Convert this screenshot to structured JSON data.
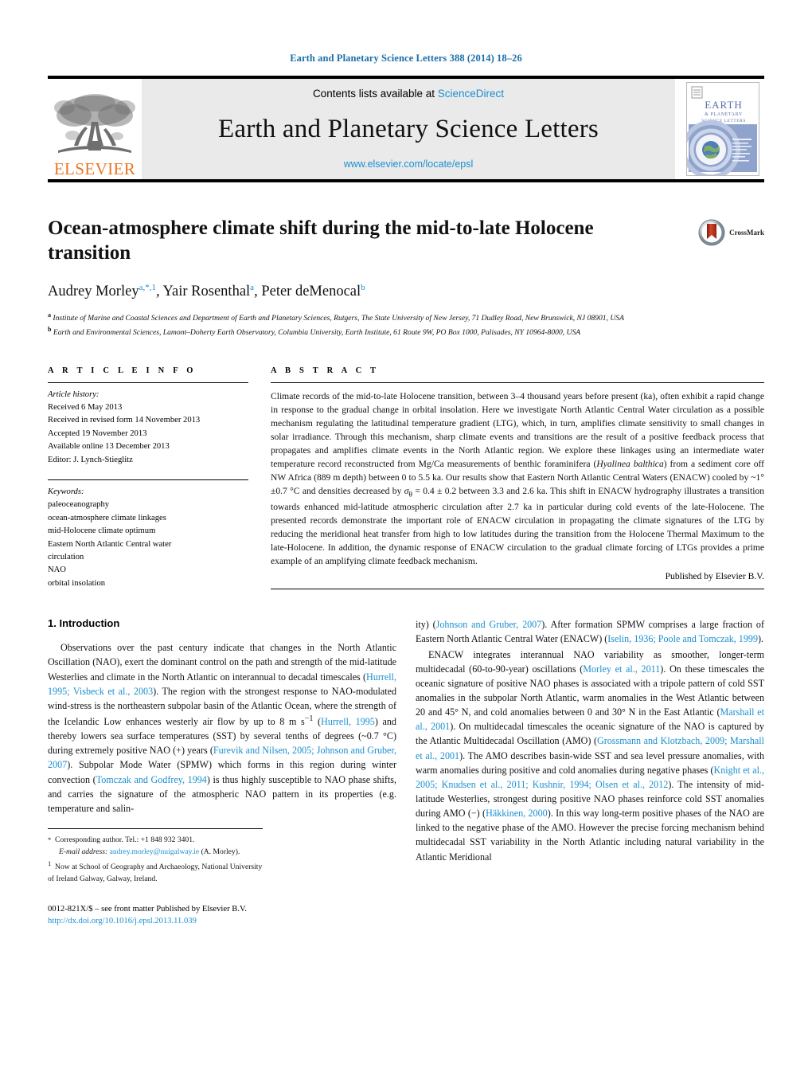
{
  "running_head": "Earth and Planetary Science Letters 388 (2014) 18–26",
  "masthead": {
    "contents_text": "Contents lists available at ",
    "sciencedirect": "ScienceDirect",
    "journal_name": "Earth and Planetary Science Letters",
    "journal_url": "www.elsevier.com/locate/epsl",
    "publisher_wordmark": "ELSEVIER",
    "cover_title_line1": "EARTH",
    "cover_title_line2": "& PLANETARY",
    "cover_title_line3": "SCIENCE LETTERS"
  },
  "crossmark": {
    "label": "CrossMark"
  },
  "article": {
    "title": "Ocean-atmosphere climate shift during the mid-to-late Holocene transition",
    "authors_html": "Audrey Morley<sup>a,*,1</sup>, Yair Rosenthal<sup>a</sup>, Peter deMenocal<sup>b</sup>",
    "affiliation_a": "Institute of Marine and Coastal Sciences and Department of Earth and Planetary Sciences, Rutgers, The State University of New Jersey, 71 Dudley Road, New Brunswick, NJ 08901, USA",
    "affiliation_b": "Earth and Environmental Sciences, Lamont–Doherty Earth Observatory, Columbia University, Earth Institute, 61 Route 9W, PO Box 1000, Palisades, NY 10964-8000, USA"
  },
  "article_info": {
    "heading": "A R T I C L E   I N F O",
    "history_label": "Article history:",
    "history": [
      "Received 6 May 2013",
      "Received in revised form 14 November 2013",
      "Accepted 19 November 2013",
      "Available online 13 December 2013",
      "Editor: J. Lynch-Stieglitz"
    ],
    "keywords_label": "Keywords:",
    "keywords": [
      "paleoceanography",
      "ocean-atmosphere climate linkages",
      "mid-Holocene climate optimum",
      "Eastern North Atlantic Central water",
      "circulation",
      "NAO",
      "orbital insolation"
    ]
  },
  "abstract": {
    "heading": "A B S T R A C T",
    "text_html": "Climate records of the mid-to-late Holocene transition, between 3–4 thousand years before present (ka), often exhibit a rapid change in response to the gradual change in orbital insolation. Here we investigate North Atlantic Central Water circulation as a possible mechanism regulating the latitudinal temperature gradient (LTG), which, in turn, amplifies climate sensitivity to small changes in solar irradiance. Through this mechanism, sharp climate events and transitions are the result of a positive feedback process that propagates and amplifies climate events in the North Atlantic region. We explore these linkages using an intermediate water temperature record reconstructed from Mg/Ca measurements of benthic foraminifera (<i>Hyalinea balthica</i>) from a sediment core off NW Africa (889 m depth) between 0 to 5.5 ka. Our results show that Eastern North Atlantic Central Waters (ENACW) cooled by ~1°±0.7 °C and densities decreased by <i>σ</i><sub>θ</sub> = 0.4 ± 0.2 between 3.3 and 2.6 ka. This shift in ENACW hydrography illustrates a transition towards enhanced mid-latitude atmospheric circulation after 2.7 ka in particular during cold events of the late-Holocene. The presented records demonstrate the important role of ENACW circulation in propagating the climate signatures of the LTG by reducing the meridional heat transfer from high to low latitudes during the transition from the Holocene Thermal Maximum to the late-Holocene. In addition, the dynamic response of ENACW circulation to the gradual climate forcing of LTGs provides a prime example of an amplifying climate feedback mechanism.",
    "published_by": "Published by Elsevier B.V."
  },
  "introduction": {
    "section_title": "1. Introduction",
    "left_paragraph_html": "Observations over the past century indicate that changes in the North Atlantic Oscillation (NAO), exert the dominant control on the path and strength of the mid-latitude Westerlies and climate in the North Atlantic on interannual to decadal timescales (<span class=\"ref\">Hurrell, 1995; Visbeck et al., 2003</span>). The region with the strongest response to NAO-modulated wind-stress is the northeastern subpolar basin of the Atlantic Ocean, where the strength of the Icelandic Low enhances westerly air flow by up to 8 m s<sup>−1</sup> (<span class=\"ref\">Hurrell, 1995</span>) and thereby lowers sea surface temperatures (SST) by several tenths of degrees (~0.7 °C) during extremely positive NAO (+) years (<span class=\"ref\">Furevik and Nilsen, 2005; Johnson and Gruber, 2007</span>). Subpolar Mode Water (SPMW) which forms in this region during winter convection (<span class=\"ref\">Tomczak and Godfrey, 1994</span>) is thus highly susceptible to NAO phase shifts, and carries the signature of the atmospheric NAO pattern in its properties (e.g. temperature and salin-",
    "right_paragraph_1_html": "ity) (<span class=\"ref\">Johnson and Gruber, 2007</span>). After formation SPMW comprises a large fraction of Eastern North Atlantic Central Water (ENACW) (<span class=\"ref\">Iselin, 1936; Poole and Tomczak, 1999</span>).",
    "right_paragraph_2_html": "ENACW integrates interannual NAO variability as smoother, longer-term multidecadal (60-to-90-year) oscillations (<span class=\"ref\">Morley et al., 2011</span>). On these timescales the oceanic signature of positive NAO phases is associated with a tripole pattern of cold SST anomalies in the subpolar North Atlantic, warm anomalies in the West Atlantic between 20 and 45° N, and cold anomalies between 0 and 30° N in the East Atlantic (<span class=\"ref\">Marshall et al., 2001</span>). On multidecadal timescales the oceanic signature of the NAO is captured by the Atlantic Multidecadal Oscillation (AMO) (<span class=\"ref\">Grossmann and Klotzbach, 2009; Marshall et al., 2001</span>). The AMO describes basin-wide SST and sea level pressure anomalies, with warm anomalies during positive and cold anomalies during negative phases (<span class=\"ref\">Knight et al., 2005; Knudsen et al., 2011; Kushnir, 1994; Olsen et al., 2012</span>). The intensity of mid-latitude Westerlies, strongest during positive NAO phases reinforce cold SST anomalies during AMO (−) (<span class=\"ref\">Häkkinen, 2000</span>). In this way long-term positive phases of the NAO are linked to the negative phase of the AMO. However the precise forcing mechanism behind multidecadal SST variability in the North Atlantic including natural variability in the Atlantic Meridional"
  },
  "footnotes": {
    "corresponding_html": "<span class=\"mark\">*</span>&nbsp;&nbsp;Corresponding author. Tel.: +1 848 932 3401.",
    "email_html": "<span class=\"ital\">E-mail address:</span> <span class=\"link\">audrey.morley@nuigalway.ie</span> (A. Morley).",
    "present_address_html": "<sup>1</sup>&nbsp;&nbsp;Now at School of Geography and Archaeology, National University of Ireland Galway, Galway, Ireland.",
    "issn_line": "0012-821X/$ – see front matter  Published by Elsevier B.V.",
    "doi_line": "http://dx.doi.org/10.1016/j.epsl.2013.11.039"
  },
  "colors": {
    "link_blue": "#1a8fd0",
    "head_blue": "#1a6fa8",
    "elsevier_orange": "#E87722",
    "panel_gray": "#eaeaea"
  }
}
